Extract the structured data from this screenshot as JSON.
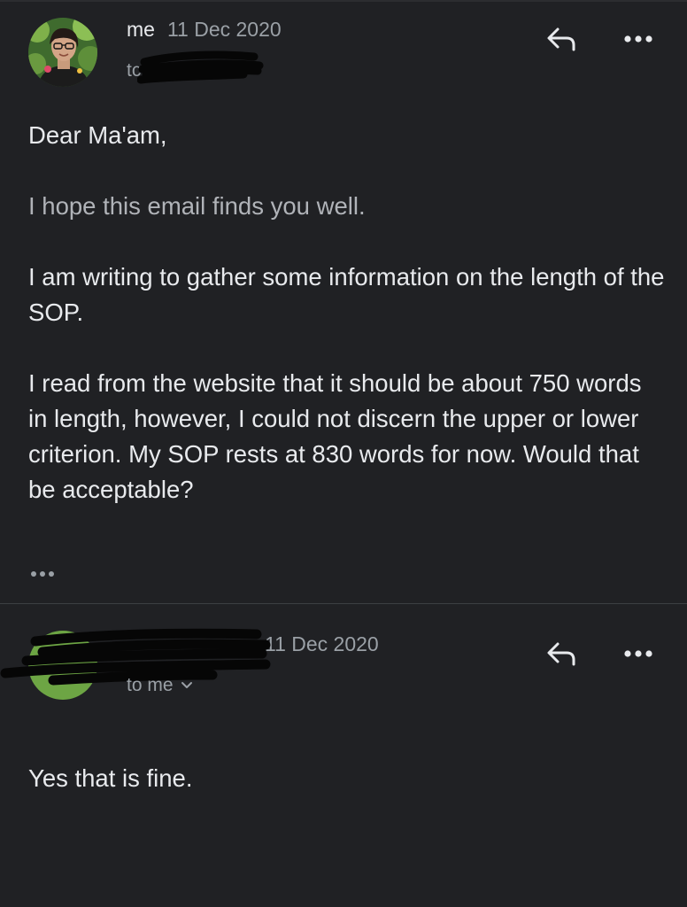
{
  "messages": [
    {
      "sender": "me",
      "date": "11 Dec 2020",
      "recipient_prefix": "tc",
      "body": [
        "Dear Ma'am,",
        "I hope this email finds you well.",
        "I am writing to gather some information on the length of the SOP.",
        "I read from the website that it should be about 750 words in length, however, I could not discern the upper or lower criterion. My SOP rests at 830 words for now. Would that be acceptable?"
      ],
      "has_trimmed_content": true
    },
    {
      "sender": "",
      "date": "11 Dec 2020",
      "recipient": "to me",
      "avatar_color": "#6da544",
      "body": [
        "Yes that is fine."
      ]
    }
  ],
  "icons": {
    "reply": "reply-icon",
    "more": "more-horizontal-icon",
    "expand": "chevron-down-icon",
    "trimmed": "more-horizontal-icon"
  },
  "colors": {
    "background": "#202124",
    "text": "#e8eaed",
    "secondary_text": "#9aa0a6",
    "divider": "#3c4043",
    "avatar_green": "#6da544"
  }
}
